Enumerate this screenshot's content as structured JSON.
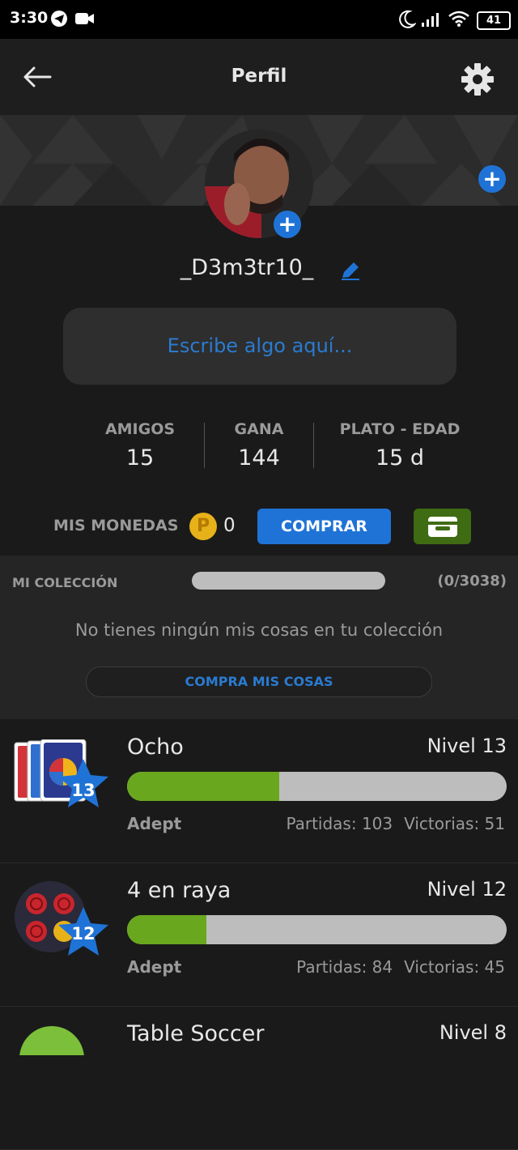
{
  "status_bar": {
    "time": "3:30",
    "battery": "41"
  },
  "header": {
    "title": "Perfil"
  },
  "profile": {
    "username": "_D3m3tr10_",
    "bio_placeholder": "Escribe algo aquí..."
  },
  "stats": [
    {
      "label": "AMIGOS",
      "value": "15"
    },
    {
      "label": "GANA",
      "value": "144"
    },
    {
      "label": "PLATO - EDAD",
      "value": "15 d"
    }
  ],
  "coins": {
    "label": "MIS MONEDAS",
    "symbol": "P",
    "value": "0",
    "buy_label": "COMPRAR"
  },
  "collection": {
    "label": "MI COLECCIÓN",
    "count": "(0/3038)",
    "empty_message": "No tienes ningún mis cosas en tu colección",
    "buy_label": "COMPRA MIS COSAS",
    "progress": 0
  },
  "games": [
    {
      "name": "Ocho",
      "level": "Nivel 13",
      "badge": "13",
      "rank": "Adept",
      "matches": "Partidas: 103",
      "wins": "Victorias: 51",
      "progress": 0.4
    },
    {
      "name": "4 en raya",
      "level": "Nivel 12",
      "badge": "12",
      "rank": "Adept",
      "matches": "Partidas: 84",
      "wins": "Victorias: 45",
      "progress": 0.21
    },
    {
      "name": "Table Soccer",
      "level": "Nivel 8"
    }
  ],
  "colors": {
    "accent": "#1f73d6",
    "progress": "#69a81e",
    "coin": "#e7b11a",
    "wallet": "#3f6b12"
  }
}
